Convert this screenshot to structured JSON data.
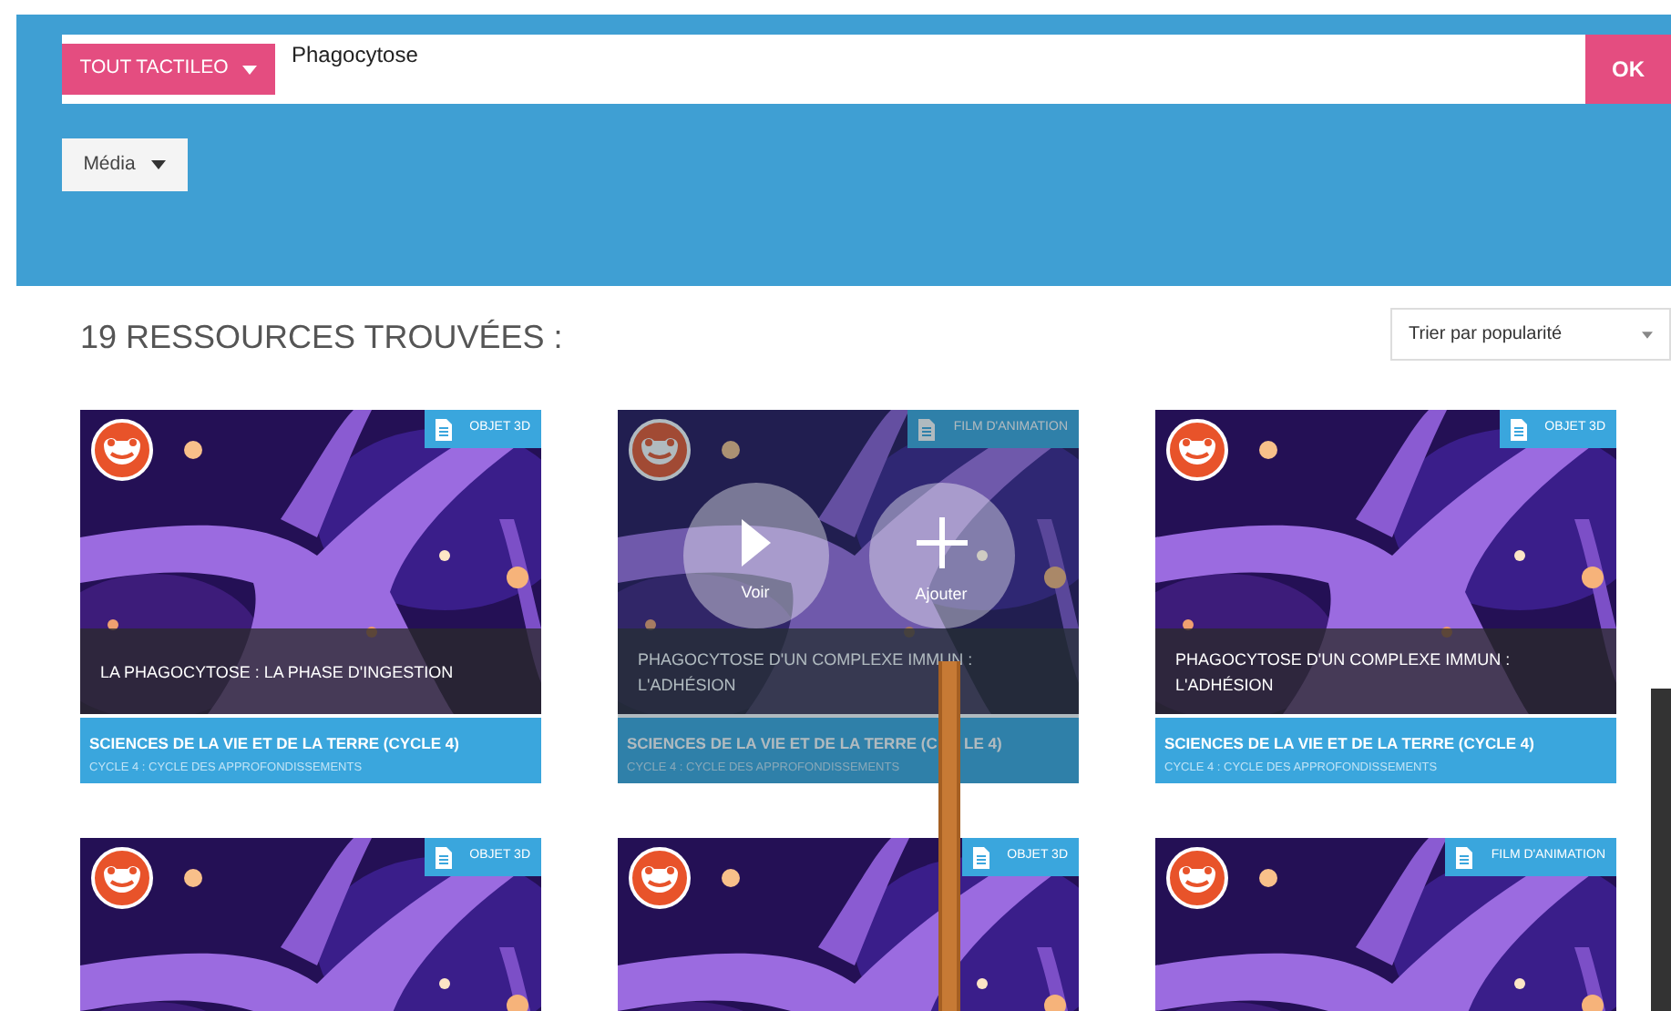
{
  "search": {
    "scope_button": "TOUT TACTILEO",
    "query": "Phagocytose",
    "submit": "OK"
  },
  "filter": {
    "label": "Média"
  },
  "results_heading": "19 RESSOURCES TROUVÉES :",
  "sort": {
    "value": "Trier par popularité"
  },
  "cards": [
    {
      "type": "OBJET 3D",
      "title": "LA PHAGOCYTOSE : LA PHASE D'INGESTION",
      "subject": "SCIENCES DE LA VIE ET DE LA TERRE (CYCLE 4)",
      "level": "CYCLE 4 : CYCLE DES APPROFONDISSEMENTS",
      "hovered": false
    },
    {
      "type": "FILM D'ANIMATION",
      "title": "PHAGOCYTOSE D'UN COMPLEXE IMMUN : L'ADHÉSION",
      "subject": "SCIENCES DE LA VIE ET DE LA TERRE (C",
      "subject_tail": "LE 4)",
      "level": "CYCLE 4 : CYCLE DES APPROFONDISSEMENTS",
      "hovered": true,
      "actions": [
        "Voir",
        "Ajouter"
      ]
    },
    {
      "type": "OBJET 3D",
      "title": "PHAGOCYTOSE D'UN COMPLEXE IMMUN : L'ADHÉSION",
      "subject": "SCIENCES DE LA VIE ET DE LA TERRE (CYCLE 4)",
      "level": "CYCLE 4 : CYCLE DES APPROFONDISSEMENTS",
      "hovered": false
    },
    {
      "type": "OBJET 3D",
      "hovered": false
    },
    {
      "type": "OBJET 3D",
      "hovered": false
    },
    {
      "type": "FILM D'ANIMATION",
      "hovered": false
    }
  ]
}
